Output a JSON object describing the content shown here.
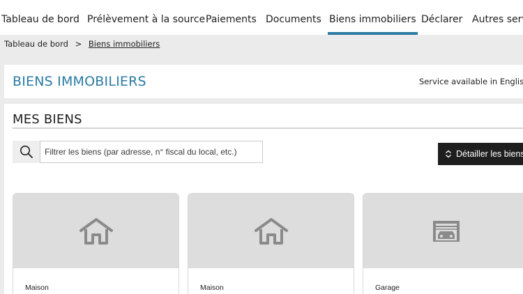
{
  "nav": {
    "tabs": [
      {
        "label": "Tableau de bord"
      },
      {
        "label": "Prélèvement à la source"
      },
      {
        "label": "Paiements"
      },
      {
        "label": "Documents"
      },
      {
        "label": "Biens immobiliers",
        "active": true
      },
      {
        "label": "Déclarer"
      },
      {
        "label": "Autres servi"
      }
    ]
  },
  "breadcrumb": {
    "home": "Tableau de bord",
    "separator": ">",
    "current": "Biens immobiliers"
  },
  "header": {
    "title": "BIENS IMMOBILIERS",
    "lang_switch": "Service available in English",
    "flag_icon": "uk-flag-icon"
  },
  "biens": {
    "section_title": "MES BIENS",
    "search": {
      "placeholder": "Filtrer les biens (par adresse, n° fiscal du local, etc.)",
      "value": "",
      "icon": "search-icon"
    },
    "detail_button": {
      "label": "Détailler les biens",
      "icon": "chevron-up-down-icon"
    },
    "cards": [
      {
        "type": "Maison",
        "icon": "house-icon"
      },
      {
        "type": "Maison",
        "icon": "house-icon"
      },
      {
        "type": "Garage",
        "icon": "garage-icon"
      }
    ]
  },
  "colors": {
    "accent": "#2a7aa3",
    "background": "#ebebeb",
    "card_image_bg": "#dedddd",
    "icon_gray": "#8a8a8a",
    "button_bg": "#1e1e1e"
  }
}
